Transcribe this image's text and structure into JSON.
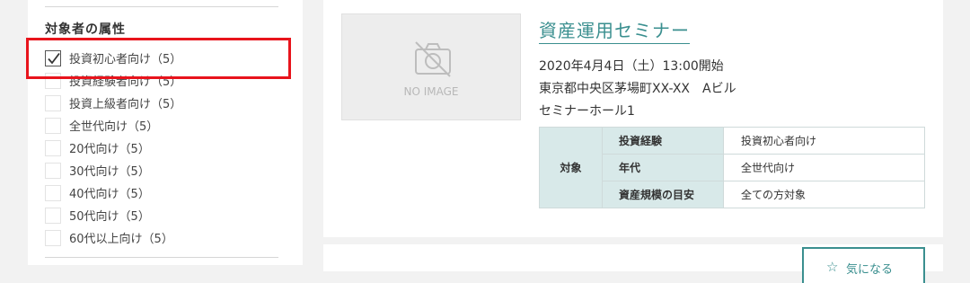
{
  "sidebar": {
    "title": "対象者の属性",
    "items": [
      {
        "label": "投資初心者向け（5）",
        "checked": true
      },
      {
        "label": "投資経験者向け（5）",
        "checked": false
      },
      {
        "label": "投資上級者向け（5）",
        "checked": false
      },
      {
        "label": "全世代向け（5）",
        "checked": false
      },
      {
        "label": "20代向け（5）",
        "checked": false
      },
      {
        "label": "30代向け（5）",
        "checked": false
      },
      {
        "label": "40代向け（5）",
        "checked": false
      },
      {
        "label": "50代向け（5）",
        "checked": false
      },
      {
        "label": "60代以上向け（5）",
        "checked": false
      }
    ]
  },
  "seminar": {
    "image_placeholder": "NO IMAGE",
    "title": "資産運用セミナー",
    "datetime": "2020年4月4日（土）13:00開始",
    "address": "東京都中央区茅場町XX-XX　Aビル",
    "venue": "セミナーホール1",
    "target_group_label": "対象",
    "targets": [
      {
        "key": "投資経験",
        "value": "投資初心者向け"
      },
      {
        "key": "年代",
        "value": "全世代向け"
      },
      {
        "key": "資産規模の目安",
        "value": "全ての方対象"
      }
    ]
  },
  "next_card": {
    "favorite_label": "気になる",
    "favorite_icon": "star-icon"
  },
  "colors": {
    "accent": "#3a8f8f",
    "highlight": "#e8141c",
    "table_header": "#d8e9e9"
  }
}
